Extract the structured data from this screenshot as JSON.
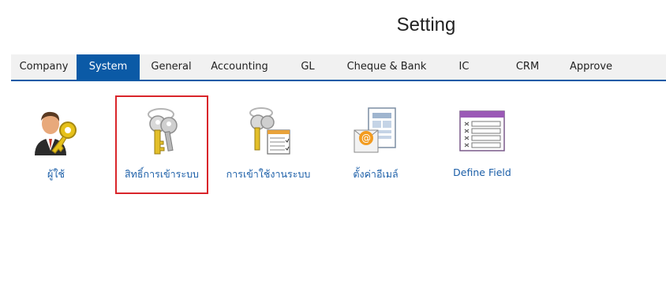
{
  "page": {
    "title": "Setting"
  },
  "tabs": [
    {
      "label": "Company",
      "active": false
    },
    {
      "label": "System",
      "active": true
    },
    {
      "label": "General",
      "active": false
    },
    {
      "label": "Accounting",
      "active": false
    },
    {
      "label": "GL",
      "active": false
    },
    {
      "label": "Cheque & Bank",
      "active": false
    },
    {
      "label": "IC",
      "active": false
    },
    {
      "label": "CRM",
      "active": false
    },
    {
      "label": "Approve",
      "active": false
    }
  ],
  "tiles": [
    {
      "label": "ผู้ใช้",
      "icon": "user-key-icon"
    },
    {
      "label": "สิทธิ์การเข้าระบบ",
      "icon": "keys-icon",
      "selected": true
    },
    {
      "label": "การเข้าใช้งานระบบ",
      "icon": "key-checklist-icon"
    },
    {
      "label": "ตั้งค่าอีเมล์",
      "icon": "email-settings-icon"
    },
    {
      "label": "Define Field",
      "icon": "define-field-icon"
    }
  ],
  "colors": {
    "accent": "#0b5aa6",
    "selection_border": "#d9252a",
    "link_text": "#1c5fa8"
  }
}
